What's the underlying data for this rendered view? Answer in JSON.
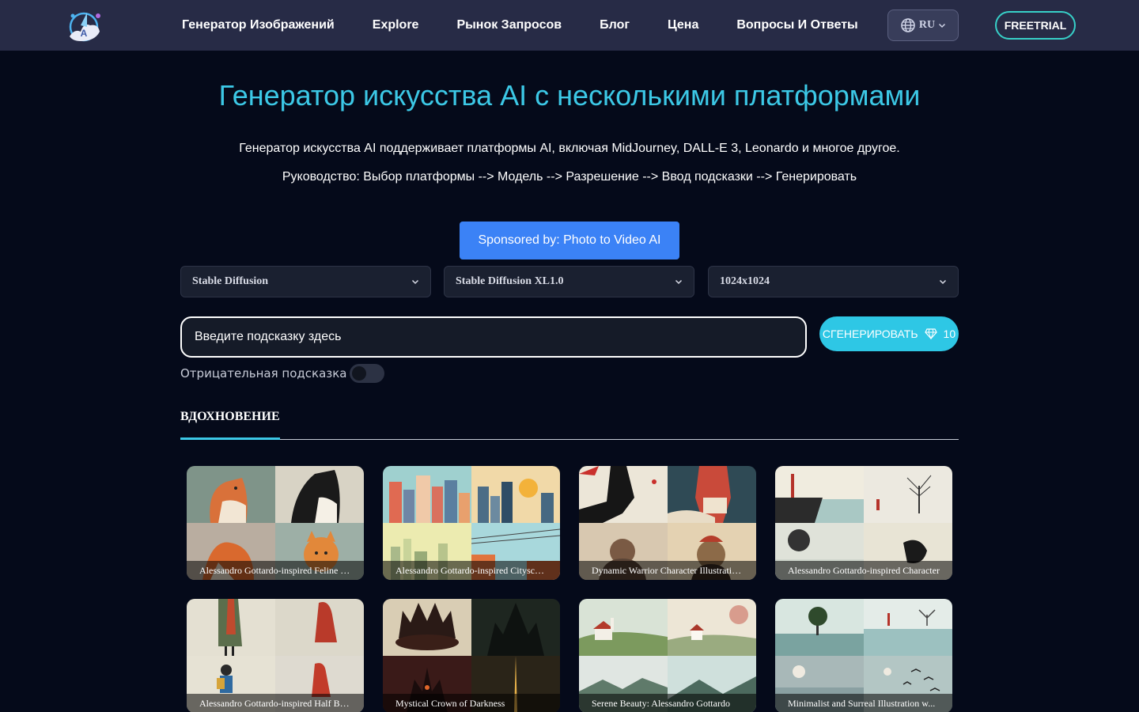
{
  "nav": {
    "links": [
      "Генератор Изображений",
      "Explore",
      "Рынок Запросов",
      "Блог",
      "Цена",
      "Вопросы И Ответы"
    ],
    "language": "RU",
    "trial_label": "FREETRIAL"
  },
  "hero": {
    "title": "Генератор искусства AI с несколькими платформами",
    "subtitle": "Генератор искусства AI поддерживает платформы AI, включая MidJourney, DALL-E 3, Leonardo и многое другое.",
    "guide": "Руководство: Выбор платформы --> Модель --> Разрешение --> Ввод подсказки --> Генерировать"
  },
  "sponsor": {
    "label": "Sponsored by: Photo to Video AI"
  },
  "selects": {
    "platform": "Stable Diffusion",
    "model": "Stable Diffusion XL1.0",
    "resolution": "1024x1024"
  },
  "prompt": {
    "placeholder": "Введите подсказку здесь"
  },
  "generate": {
    "label": "СГЕНЕРИРОВАТЬ",
    "cost": "10"
  },
  "negative": {
    "label": "Отрицательная подсказка"
  },
  "tab": {
    "label": "ВДОХНОВЕНИЕ"
  },
  "gallery": [
    "Alessandro Gottardo-inspired Feline Illustrations",
    "Alessandro Gottardo-inspired Cityscape",
    "Dynamic Warrior Character Illustrations",
    "Alessandro Gottardo-inspired Character",
    "Alessandro Gottardo-inspired Half Body",
    "Mystical Crown of Darkness",
    "Serene Beauty: Alessandro Gottardo",
    "Minimalist and Surreal Illustration w..."
  ],
  "colors": {
    "nav_bg": "#272b46",
    "page_bg": "#050a1a",
    "accent": "#3cc8e6",
    "sponsor": "#3b82f6",
    "generate": "#2ec7e5"
  }
}
